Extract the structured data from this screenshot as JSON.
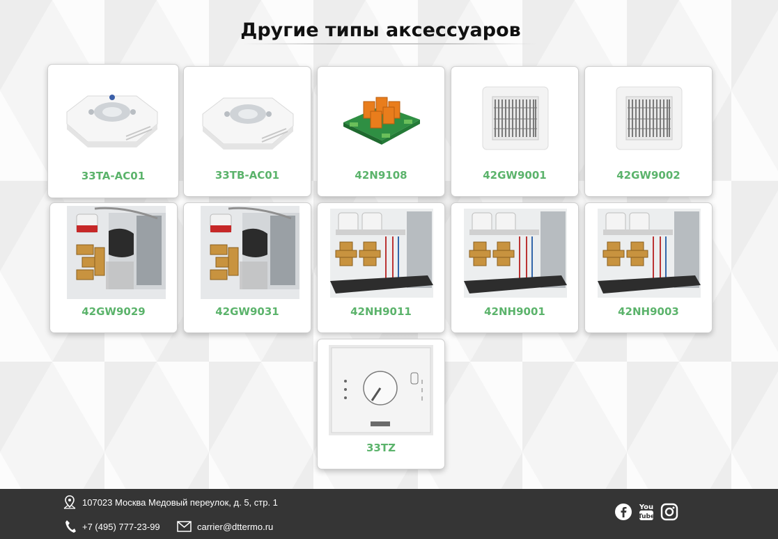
{
  "page": {
    "title": "Другие типы аксессуаров"
  },
  "products": [
    {
      "label": "33TA-AC01",
      "image": "ceiling-controller-panel"
    },
    {
      "label": "33TB-AC01",
      "image": "ceiling-controller-panel"
    },
    {
      "label": "42N9108",
      "image": "relay-board"
    },
    {
      "label": "42GW9001",
      "image": "cassette-grille"
    },
    {
      "label": "42GW9002",
      "image": "cassette-grille"
    },
    {
      "label": "42GW9029",
      "image": "valve-kit"
    },
    {
      "label": "42GW9031",
      "image": "valve-kit"
    },
    {
      "label": "42NH9011",
      "image": "valve-assembly"
    },
    {
      "label": "42NH9001",
      "image": "valve-assembly"
    },
    {
      "label": "42NH9003",
      "image": "valve-assembly"
    },
    {
      "label": "33TZ",
      "image": "wall-thermostat"
    }
  ],
  "footer": {
    "address": "107023 Москва Медовый переулок, д. 5, стр. 1",
    "phone": "+7 (495) 777-23-99",
    "email": "carrier@dttermo.ru",
    "icons": [
      "map-pin-icon",
      "phone-icon",
      "envelope-icon",
      "facebook-icon",
      "youtube-icon",
      "instagram-icon"
    ]
  },
  "colors": {
    "accent": "#5bb36b",
    "footer_bg": "#353535"
  }
}
